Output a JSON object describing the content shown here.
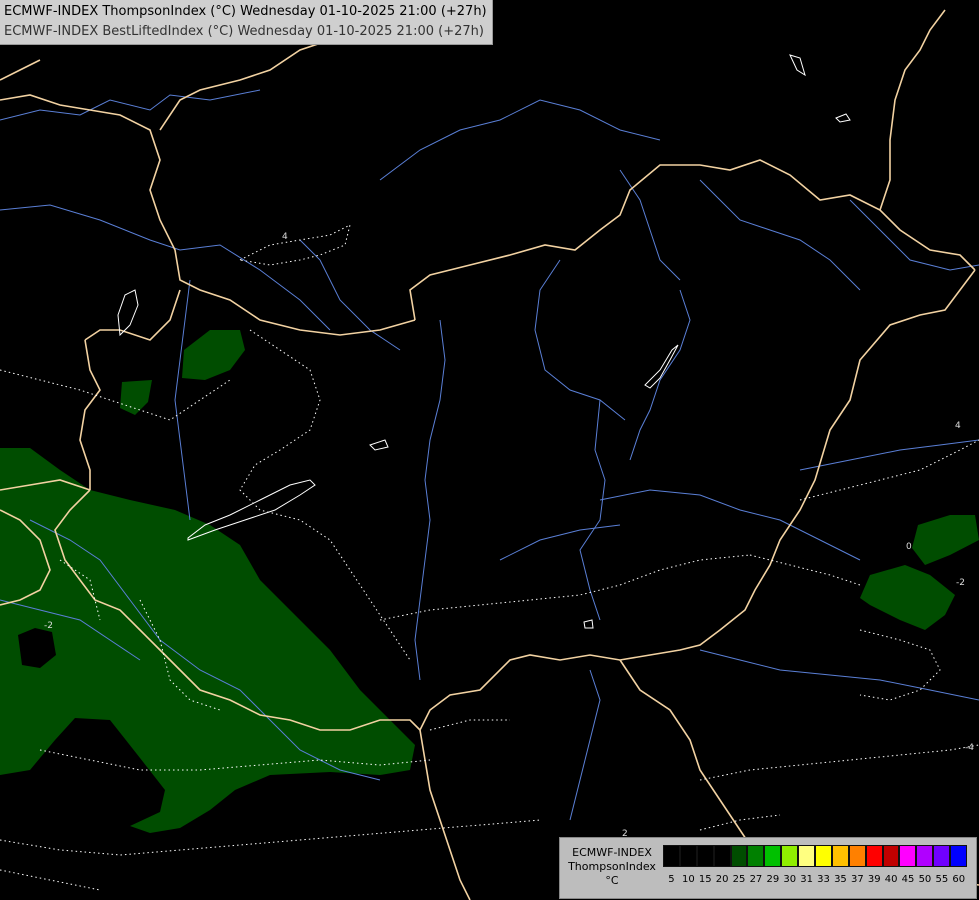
{
  "header": {
    "line1": "ECMWF-INDEX ThompsonIndex (°C) Wednesday 01-10-2025 21:00 (+27h)",
    "line2": "ECMWF-INDEX BestLiftedIndex (°C) Wednesday 01-10-2025 21:00 (+27h)"
  },
  "legend": {
    "title_line1": "ECMWF-INDEX",
    "title_line2": "ThompsonIndex",
    "unit": "°C",
    "ticks": [
      "5",
      "10",
      "15",
      "20",
      "25",
      "27",
      "29",
      "30",
      "31",
      "33",
      "35",
      "37",
      "39",
      "40",
      "45",
      "50",
      "55",
      "60"
    ],
    "colors": [
      "#000000",
      "#000000",
      "#000000",
      "#000000",
      "#004d00",
      "#008000",
      "#00c000",
      "#90ee00",
      "#ffff80",
      "#ffff00",
      "#ffc000",
      "#ff8000",
      "#ff0000",
      "#c00000",
      "#ff00ff",
      "#b000ff",
      "#7000ff",
      "#0000ff"
    ]
  },
  "contour_labels": [
    "4",
    "-2",
    "0",
    "-2",
    "2",
    "-4",
    "4"
  ],
  "colors": {
    "background": "#000000",
    "borders": "#f2d2a2",
    "rivers": "#5a7fd6",
    "field": "#004d00",
    "contours": "#ffffff"
  }
}
